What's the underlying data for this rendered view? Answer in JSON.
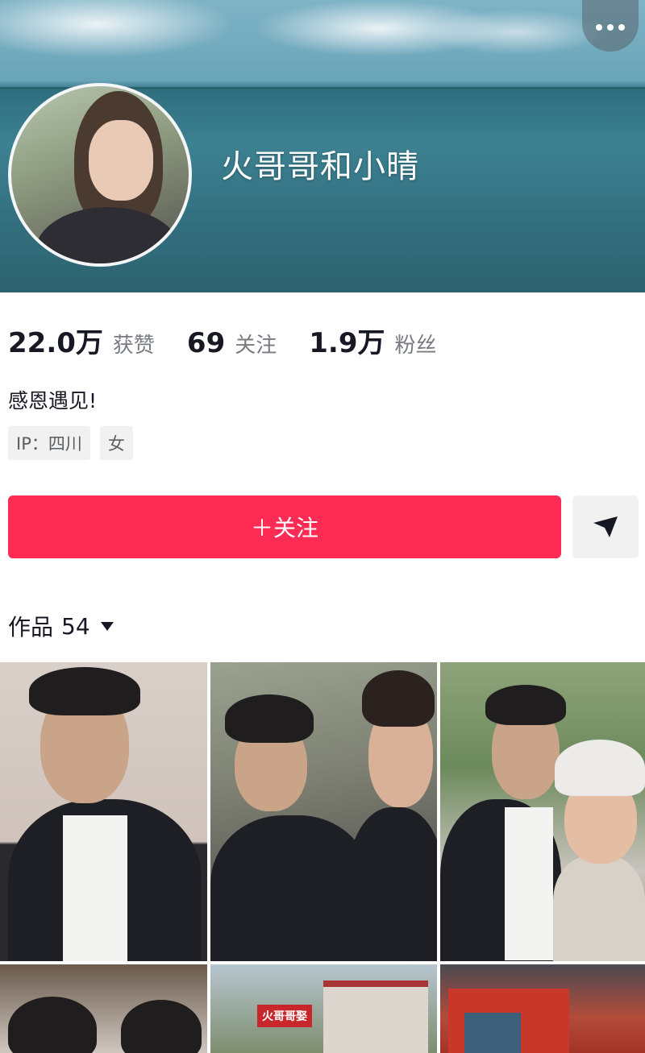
{
  "profile": {
    "nickname": "火哥哥和小晴",
    "bio": "感恩遇见!",
    "tags": [
      "IP：四川",
      "女"
    ]
  },
  "stats": [
    {
      "value": "22.0万",
      "label": "获赞"
    },
    {
      "value": "69",
      "label": "关注"
    },
    {
      "value": "1.9万",
      "label": "粉丝"
    }
  ],
  "actions": {
    "follow_label": "＋关注"
  },
  "works": {
    "title": "作品",
    "count": "54"
  },
  "grid": {
    "sign_text": "火哥哥娶"
  },
  "colors": {
    "follow": "#fe2c55",
    "secondary_bg": "#f1f1f2"
  }
}
